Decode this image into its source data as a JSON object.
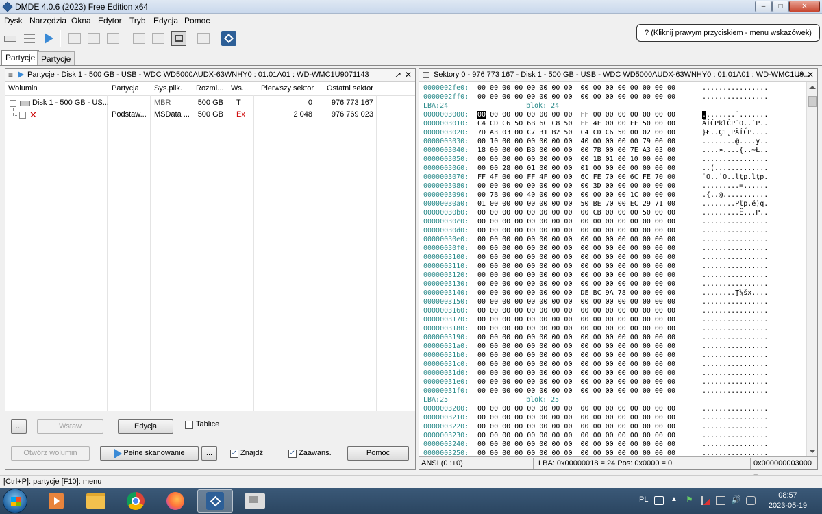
{
  "window": {
    "title": "DMDE 4.0.6 (2023) Free Edition x64",
    "minimize": "–",
    "maximize": "□",
    "close": "✕"
  },
  "menu": [
    "Dysk",
    "Narzędzia",
    "Okna",
    "Edytor",
    "Tryb",
    "Edycja",
    "Pomoc"
  ],
  "hint": "? (Kliknij prawym przyciskiem - menu wskazówek)",
  "tabs": [
    "Partycje",
    "Partycje"
  ],
  "left_panel": {
    "menu_glyph": "≡",
    "title": "Partycje - Disk 1 - 500 GB - USB - WDC WD5000AUDX-63WNHY0 : 01.01A01 : WD-WMC1U9071143",
    "max_glyph": "↗",
    "close_glyph": "✕",
    "columns": [
      "Wolumin",
      "Partycja",
      "Sys.plik.",
      "Rozmi...",
      "Ws...",
      "Pierwszy sektor",
      "Ostatni sektor"
    ],
    "rows": [
      {
        "volume": "Disk 1 - 500 GB - US...",
        "partition": "",
        "fs": "MBR",
        "size": "500 GB",
        "flag": "T",
        "first": "0",
        "last": "976 773 167"
      },
      {
        "volume": "",
        "partition": "Podstaw...",
        "fs": "MSData ...",
        "size": "500 GB",
        "flag": "Ex",
        "first": "2 048",
        "last": "976 769 023"
      }
    ],
    "buttons": {
      "dots1": "...",
      "insert": "Wstaw",
      "edit": "Edycja",
      "tables": "Tablice",
      "open_volume": "Otwórz wolumin",
      "full_scan": "Pełne skanowanie",
      "dots2": "...",
      "find": "Znajdź",
      "advanced": "Zaawans.",
      "help": "Pomoc"
    }
  },
  "right_panel": {
    "title": "Sektory 0 - 976 773 167 - Disk 1 - 500 GB - USB - WDC WD5000AUDX-63WNHY0 : 01.01A01 : WD-WMC1U9...",
    "max_glyph": "↗",
    "close_glyph": "✕",
    "rows": [
      {
        "off": "0000002fe0:",
        "bytes": "00 00 00 00 00 00 00 00  00 00 00 00 00 00 00 00",
        "ascii": "................"
      },
      {
        "off": "0000002ff0:",
        "bytes": "00 00 00 00 00 00 00 00  00 00 00 00 00 00 00 00",
        "ascii": "................"
      },
      {
        "lba": "LBA:24",
        "blk": "blok: 24"
      },
      {
        "off": "0000003000:",
        "bytes": "00 00 00 00 00 00 00 00  FF 00 00 00 00 00 00 00",
        "ascii": "........˙.......",
        "cursor": true
      },
      {
        "off": "0000003010:",
        "bytes": "C4 CD C6 50 6B 6C C8 50  FF 4F 00 00 FF 50 00 00",
        "ascii": "ÄÍĆPklČP˙O..˙P.."
      },
      {
        "off": "0000003020:",
        "bytes": "7D A3 03 00 C7 31 B2 50  C4 CD C6 50 00 02 00 00",
        "ascii": "}Ł..Ç1˛PÄÍĆP...."
      },
      {
        "off": "0000003030:",
        "bytes": "00 10 00 00 00 00 00 00  40 00 00 00 00 79 00 00",
        "ascii": "........@....y.."
      },
      {
        "off": "0000003040:",
        "bytes": "18 00 00 00 BB 00 00 00  00 7B 00 00 7E A3 03 00",
        "ascii": "....»....{..~Ł.."
      },
      {
        "off": "0000003050:",
        "bytes": "00 00 00 00 00 00 00 00  00 1B 01 00 10 00 00 00",
        "ascii": "................"
      },
      {
        "off": "0000003060:",
        "bytes": "00 00 28 00 01 00 00 00  01 00 00 00 00 00 00 00",
        "ascii": "..(............."
      },
      {
        "off": "0000003070:",
        "bytes": "FF 4F 00 00 FF 4F 00 00  6C FE 70 00 6C FE 70 00",
        "ascii": "˙O..˙O..lţp.lţp."
      },
      {
        "off": "0000003080:",
        "bytes": "00 00 00 00 00 00 00 00  00 3D 00 00 00 00 00 00",
        "ascii": ".........=......"
      },
      {
        "off": "0000003090:",
        "bytes": "00 7B 00 00 40 00 00 00  00 00 00 00 1C 00 00 00",
        "ascii": ".{..@..........."
      },
      {
        "off": "00000030a0:",
        "bytes": "01 00 00 00 00 00 00 00  50 BE 70 00 EC 29 71 00",
        "ascii": "........Pľp.ě)q."
      },
      {
        "off": "00000030b0:",
        "bytes": "00 00 00 00 00 00 00 00  00 CB 00 00 00 50 00 00",
        "ascii": ".........Ë...P.."
      },
      {
        "off": "00000030c0:",
        "bytes": "00 00 00 00 00 00 00 00  00 00 00 00 00 00 00 00",
        "ascii": "................"
      },
      {
        "off": "00000030d0:",
        "bytes": "00 00 00 00 00 00 00 00  00 00 00 00 00 00 00 00",
        "ascii": "................"
      },
      {
        "off": "00000030e0:",
        "bytes": "00 00 00 00 00 00 00 00  00 00 00 00 00 00 00 00",
        "ascii": "................"
      },
      {
        "off": "00000030f0:",
        "bytes": "00 00 00 00 00 00 00 00  00 00 00 00 00 00 00 00",
        "ascii": "................"
      },
      {
        "off": "0000003100:",
        "bytes": "00 00 00 00 00 00 00 00  00 00 00 00 00 00 00 00",
        "ascii": "................"
      },
      {
        "off": "0000003110:",
        "bytes": "00 00 00 00 00 00 00 00  00 00 00 00 00 00 00 00",
        "ascii": "................"
      },
      {
        "off": "0000003120:",
        "bytes": "00 00 00 00 00 00 00 00  00 00 00 00 00 00 00 00",
        "ascii": "................"
      },
      {
        "off": "0000003130:",
        "bytes": "00 00 00 00 00 00 00 00  00 00 00 00 00 00 00 00",
        "ascii": "................"
      },
      {
        "off": "0000003140:",
        "bytes": "00 00 00 00 00 00 00 00  DE BC 9A 78 00 00 00 00",
        "ascii": "........Ţ¼šx...."
      },
      {
        "off": "0000003150:",
        "bytes": "00 00 00 00 00 00 00 00  00 00 00 00 00 00 00 00",
        "ascii": "................"
      },
      {
        "off": "0000003160:",
        "bytes": "00 00 00 00 00 00 00 00  00 00 00 00 00 00 00 00",
        "ascii": "................"
      },
      {
        "off": "0000003170:",
        "bytes": "00 00 00 00 00 00 00 00  00 00 00 00 00 00 00 00",
        "ascii": "................"
      },
      {
        "off": "0000003180:",
        "bytes": "00 00 00 00 00 00 00 00  00 00 00 00 00 00 00 00",
        "ascii": "................"
      },
      {
        "off": "0000003190:",
        "bytes": "00 00 00 00 00 00 00 00  00 00 00 00 00 00 00 00",
        "ascii": "................"
      },
      {
        "off": "00000031a0:",
        "bytes": "00 00 00 00 00 00 00 00  00 00 00 00 00 00 00 00",
        "ascii": "................"
      },
      {
        "off": "00000031b0:",
        "bytes": "00 00 00 00 00 00 00 00  00 00 00 00 00 00 00 00",
        "ascii": "................"
      },
      {
        "off": "00000031c0:",
        "bytes": "00 00 00 00 00 00 00 00  00 00 00 00 00 00 00 00",
        "ascii": "................"
      },
      {
        "off": "00000031d0:",
        "bytes": "00 00 00 00 00 00 00 00  00 00 00 00 00 00 00 00",
        "ascii": "................"
      },
      {
        "off": "00000031e0:",
        "bytes": "00 00 00 00 00 00 00 00  00 00 00 00 00 00 00 00",
        "ascii": "................"
      },
      {
        "off": "00000031f0:",
        "bytes": "00 00 00 00 00 00 00 00  00 00 00 00 00 00 00 00",
        "ascii": "................"
      },
      {
        "lba": "LBA:25",
        "blk": "blok: 25"
      },
      {
        "off": "0000003200:",
        "bytes": "00 00 00 00 00 00 00 00  00 00 00 00 00 00 00 00",
        "ascii": "................"
      },
      {
        "off": "0000003210:",
        "bytes": "00 00 00 00 00 00 00 00  00 00 00 00 00 00 00 00",
        "ascii": "................"
      },
      {
        "off": "0000003220:",
        "bytes": "00 00 00 00 00 00 00 00  00 00 00 00 00 00 00 00",
        "ascii": "................"
      },
      {
        "off": "0000003230:",
        "bytes": "00 00 00 00 00 00 00 00  00 00 00 00 00 00 00 00",
        "ascii": "................"
      },
      {
        "off": "0000003240:",
        "bytes": "00 00 00 00 00 00 00 00  00 00 00 00 00 00 00 00",
        "ascii": "................"
      },
      {
        "off": "0000003250:",
        "bytes": "00 00 00 00 00 00 00 00  00 00 00 00 00 00 00 00",
        "ascii": "................"
      }
    ],
    "status": {
      "encoding": "ANSI (0 :+0)",
      "position": "LBA: 0x00000018 = 24  Pos: 0x0000 = 0",
      "offset": "0x000000003000 ="
    }
  },
  "statusbar": "[Ctrl+P]: partycje  [F10]: menu",
  "taskbar": {
    "lang": "PL",
    "time": "08:57",
    "date": "2023-05-19"
  },
  "colors": {
    "offset": "#2a8a8a",
    "accent": "#2d5f97",
    "cursor": "#000000"
  }
}
